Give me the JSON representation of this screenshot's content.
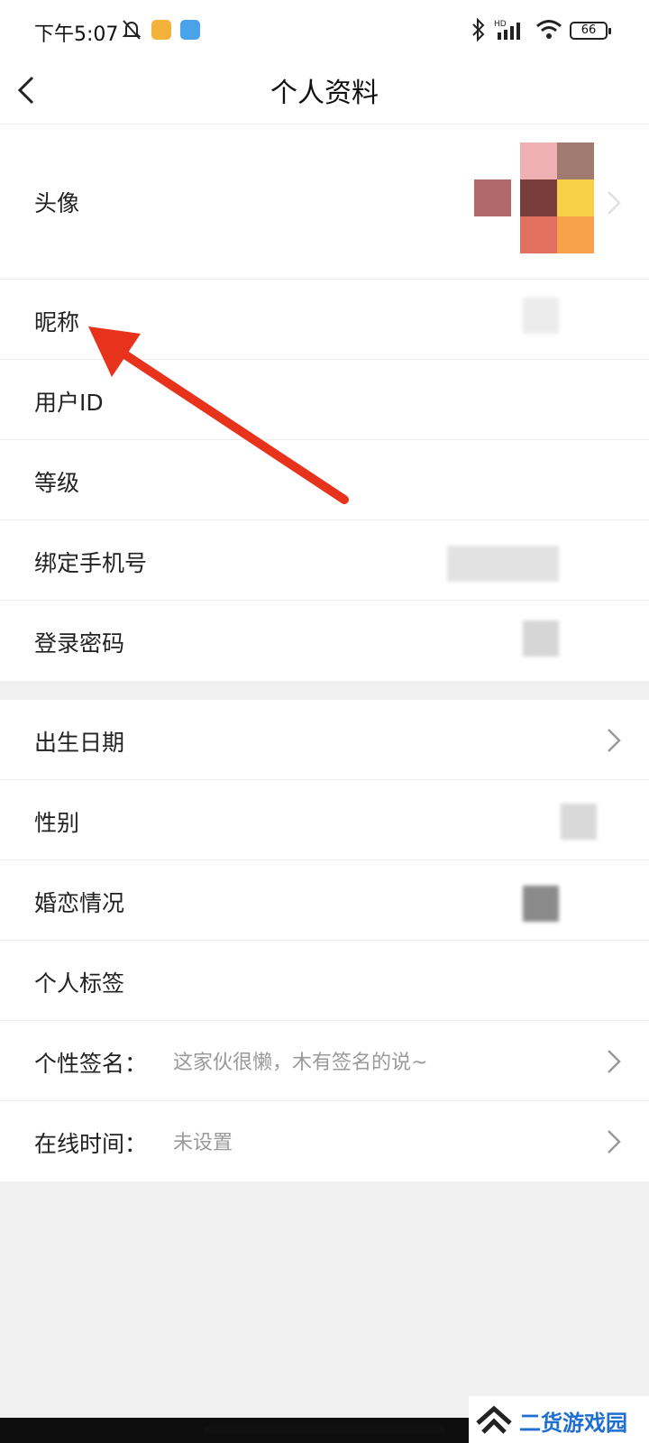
{
  "status_bar": {
    "time": "下午5:07",
    "battery": "66",
    "icons": [
      "bell-off-icon",
      "notification-app-icon",
      "weather-icon",
      "bluetooth-icon",
      "hd-signal-icon",
      "wifi-icon",
      "battery-icon"
    ]
  },
  "nav": {
    "title": "个人资料",
    "back_icon": "chevron-left-icon"
  },
  "profile": {
    "rows_group1": [
      {
        "label": "头像"
      },
      {
        "label": "昵称"
      },
      {
        "label": "用户ID"
      },
      {
        "label": "等级"
      },
      {
        "label": "绑定手机号"
      },
      {
        "label": "登录密码"
      }
    ],
    "rows_group2": [
      {
        "label": "出生日期"
      },
      {
        "label": "性别"
      },
      {
        "label": "婚恋情况"
      },
      {
        "label": "个人标签"
      },
      {
        "label": "个性签名：",
        "hint": "这家伙很懒，木有签名的说~"
      },
      {
        "label": "在线时间：",
        "hint": "未设置"
      }
    ]
  },
  "watermark": {
    "text": "二货游戏园"
  },
  "colors": {
    "annotation_arrow": "#e8331c",
    "watermark_text": "#1f6fd1",
    "background": "#f0f0f0"
  }
}
